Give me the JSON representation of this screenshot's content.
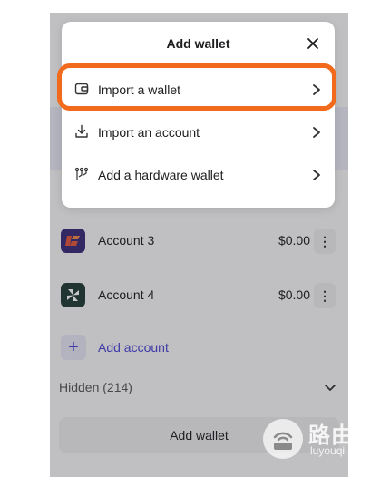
{
  "modal": {
    "title": "Add wallet",
    "items": [
      {
        "label": "Import a wallet"
      },
      {
        "label": "Import an account"
      },
      {
        "label": "Add a hardware wallet"
      }
    ]
  },
  "accounts": [
    {
      "name": "Account 3",
      "balance": "$0.00",
      "avatar_color": "#3b2a7a"
    },
    {
      "name": "Account 4",
      "balance": "$0.00",
      "avatar_color": "#1f3b35"
    }
  ],
  "add_account_label": "Add account",
  "hidden_label": "Hidden (214)",
  "add_wallet_button": "Add wallet",
  "watermark": {
    "big": "路由器",
    "small": "luyouqi.com"
  },
  "colors": {
    "accent": "#4b44d6",
    "highlight": "#f26a1b"
  }
}
